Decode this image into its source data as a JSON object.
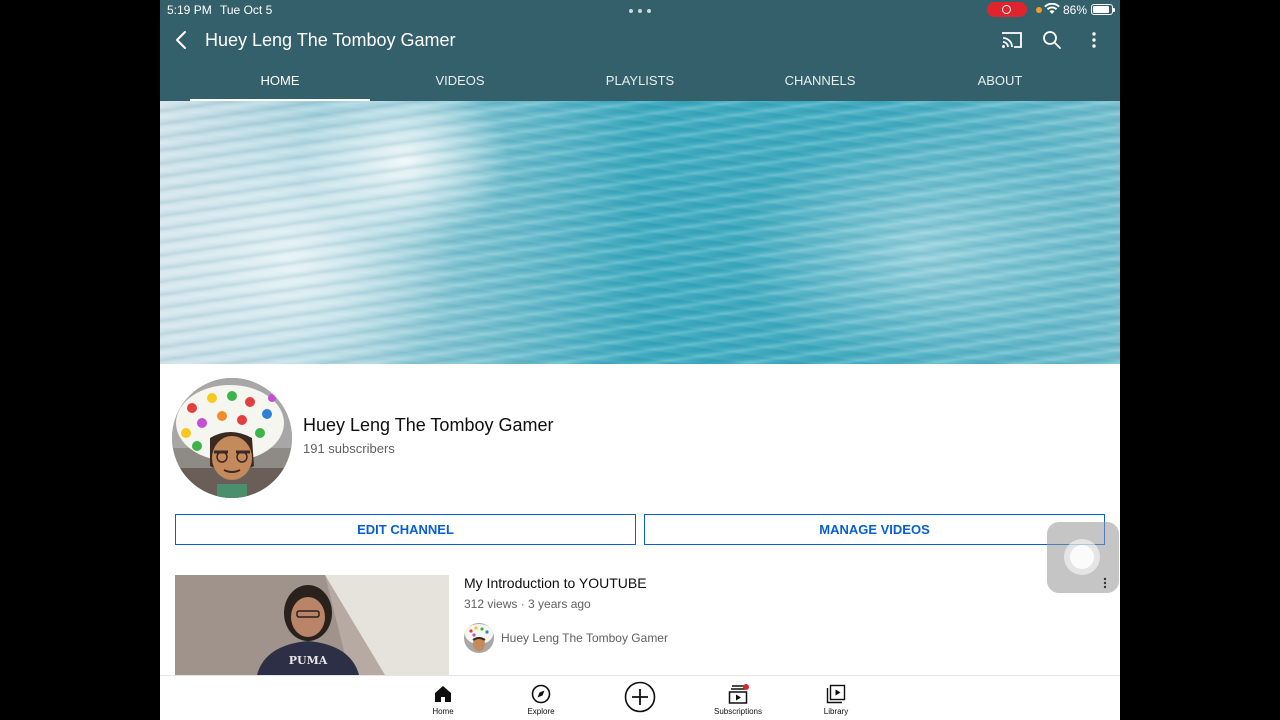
{
  "status_bar": {
    "time": "5:19 PM",
    "date": "Tue Oct 5",
    "battery": "86%"
  },
  "app_bar": {
    "title": "Huey Leng The Tomboy Gamer"
  },
  "tabs": [
    {
      "label": "HOME",
      "active": true
    },
    {
      "label": "VIDEOS",
      "active": false
    },
    {
      "label": "PLAYLISTS",
      "active": false
    },
    {
      "label": "CHANNELS",
      "active": false
    },
    {
      "label": "ABOUT",
      "active": false
    }
  ],
  "channel": {
    "name": "Huey Leng The Tomboy Gamer",
    "subscribers": "191 subscribers",
    "edit_button": "EDIT CHANNEL",
    "manage_button": "MANAGE VIDEOS"
  },
  "video": {
    "title": "My Introduction to YOUTUBE",
    "meta": "312 views · 3 years ago",
    "channel": "Huey Leng The Tomboy Gamer",
    "shirt_text": "PUMA"
  },
  "bottom_nav": [
    {
      "label": "Home",
      "icon": "home-icon"
    },
    {
      "label": "Explore",
      "icon": "compass-icon"
    },
    {
      "label": "",
      "icon": "create-plus-icon"
    },
    {
      "label": "Subscriptions",
      "icon": "subscriptions-icon"
    },
    {
      "label": "Library",
      "icon": "library-icon"
    }
  ],
  "colors": {
    "header": "#34606c",
    "accent_blue": "#065fd4",
    "notification_dot": "#e0242e"
  }
}
